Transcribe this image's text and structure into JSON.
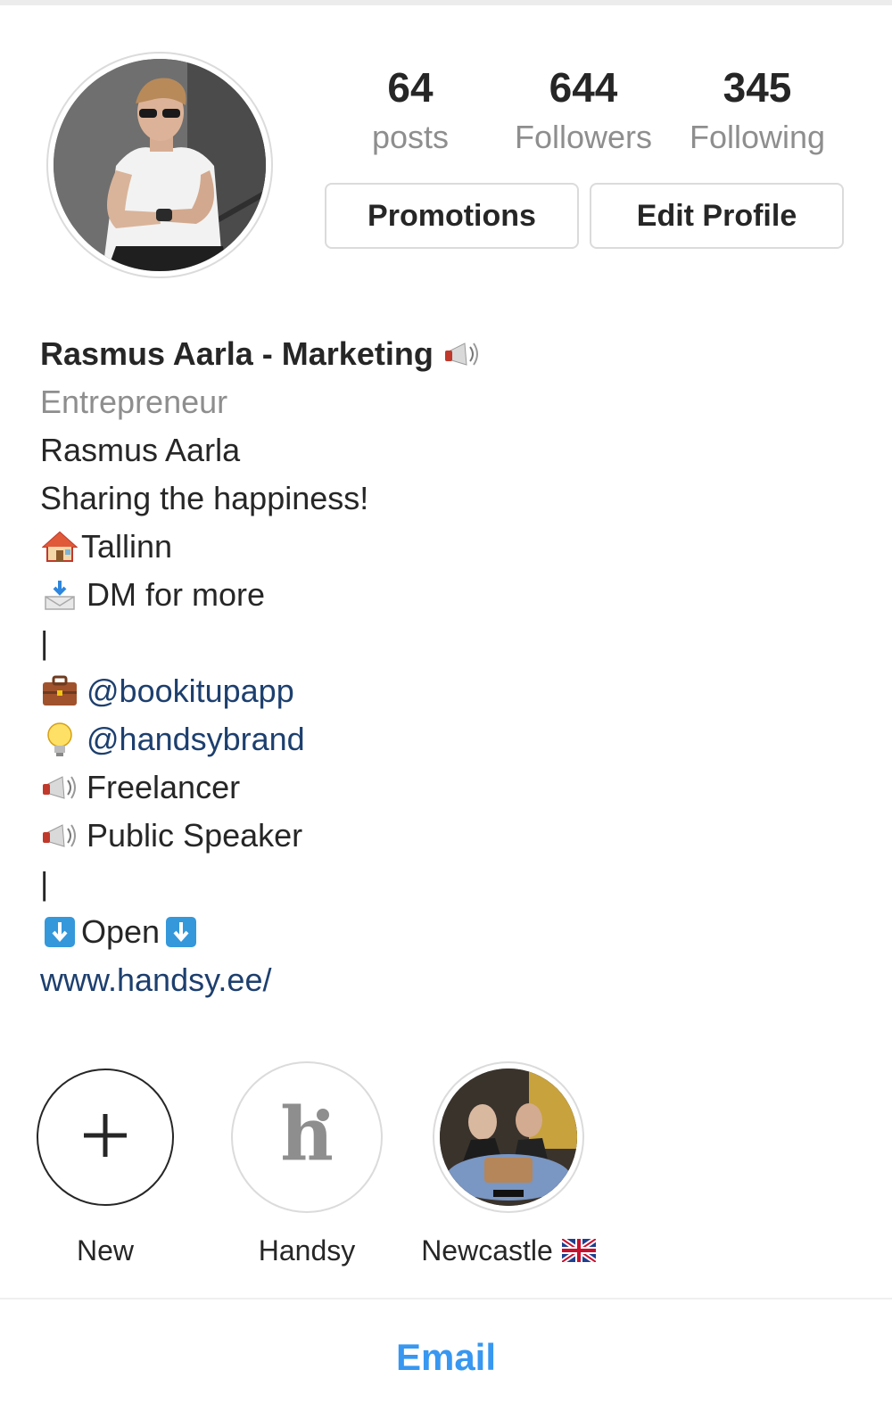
{
  "stats": {
    "posts": {
      "count": "64",
      "label": "posts"
    },
    "followers": {
      "count": "644",
      "label": "Followers"
    },
    "following": {
      "count": "345",
      "label": "Following"
    }
  },
  "buttons": {
    "promotions": "Promotions",
    "edit_profile": "Edit Profile"
  },
  "bio": {
    "display_name": "Rasmus Aarla - Marketing",
    "name_icon": "megaphone-icon",
    "category": "Entrepreneur",
    "lines": {
      "name": "Rasmus Aarla",
      "tagline": "Sharing the happiness!",
      "location": "Tallinn",
      "dm": "DM for more",
      "separator1": "|",
      "mention1": "@bookitupapp",
      "mention2": "@handsybrand",
      "role1": "Freelancer",
      "role2": "Public Speaker",
      "separator2": "|",
      "open": "Open"
    },
    "website": "www.handsy.ee/"
  },
  "highlights": [
    {
      "label": "New",
      "icon": "plus-icon"
    },
    {
      "label": "Handsy",
      "icon": "handsy-logo"
    },
    {
      "label": "Newcastle",
      "icon": "uk-flag-icon"
    }
  ],
  "footer": {
    "email": "Email"
  },
  "colors": {
    "link": "#1d3f6e",
    "email": "#3897f0",
    "muted": "#8e8e8e",
    "text": "#262626"
  }
}
